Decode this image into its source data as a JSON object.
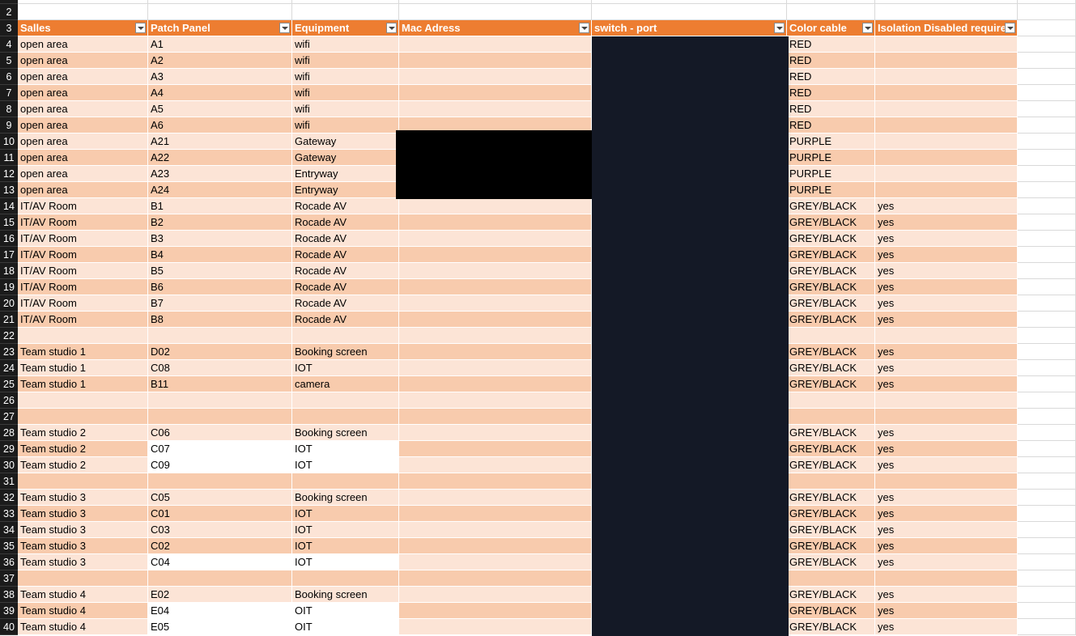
{
  "spreadsheet": {
    "columns": [
      "Salles",
      "Patch Panel",
      "Equipment",
      "Mac Adress",
      "switch - port",
      "Color cable",
      "Isolation Disabled require"
    ],
    "header_row_number": "3",
    "empty_top_rows": [
      "",
      "2"
    ],
    "rows": [
      {
        "n": "4",
        "salle": "open area",
        "patch": "A1",
        "equip": "wifi",
        "color": "RED",
        "iso": ""
      },
      {
        "n": "5",
        "salle": "open area",
        "patch": "A2",
        "equip": "wifi",
        "color": "RED",
        "iso": ""
      },
      {
        "n": "6",
        "salle": "open area",
        "patch": "A3",
        "equip": "wifi",
        "color": "RED",
        "iso": ""
      },
      {
        "n": "7",
        "salle": "open area",
        "patch": "A4",
        "equip": "wifi",
        "color": "RED",
        "iso": ""
      },
      {
        "n": "8",
        "salle": "open area",
        "patch": "A5",
        "equip": "wifi",
        "color": "RED",
        "iso": ""
      },
      {
        "n": "9",
        "salle": "open area",
        "patch": "A6",
        "equip": "wifi",
        "color": "RED",
        "iso": ""
      },
      {
        "n": "10",
        "salle": "open area",
        "patch": "A21",
        "equip": "Gateway",
        "color": "PURPLE",
        "iso": ""
      },
      {
        "n": "11",
        "salle": "open area",
        "patch": "A22",
        "equip": "Gateway",
        "color": "PURPLE",
        "iso": ""
      },
      {
        "n": "12",
        "salle": "open area",
        "patch": "A23",
        "equip": "Entryway",
        "color": "PURPLE",
        "iso": ""
      },
      {
        "n": "13",
        "salle": "open area",
        "patch": "A24",
        "equip": "Entryway",
        "color": "PURPLE",
        "iso": ""
      },
      {
        "n": "14",
        "salle": "IT/AV Room",
        "patch": "B1",
        "equip": "Rocade AV",
        "color": "GREY/BLACK",
        "iso": "yes"
      },
      {
        "n": "15",
        "salle": "IT/AV Room",
        "patch": "B2",
        "equip": "Rocade AV",
        "color": "GREY/BLACK",
        "iso": "yes"
      },
      {
        "n": "16",
        "salle": "IT/AV Room",
        "patch": "B3",
        "equip": "Rocade AV",
        "color": "GREY/BLACK",
        "iso": "yes"
      },
      {
        "n": "17",
        "salle": "IT/AV Room",
        "patch": "B4",
        "equip": "Rocade AV",
        "color": "GREY/BLACK",
        "iso": "yes"
      },
      {
        "n": "18",
        "salle": "IT/AV Room",
        "patch": "B5",
        "equip": "Rocade AV",
        "color": "GREY/BLACK",
        "iso": "yes"
      },
      {
        "n": "19",
        "salle": "IT/AV Room",
        "patch": "B6",
        "equip": "Rocade AV",
        "color": "GREY/BLACK",
        "iso": "yes"
      },
      {
        "n": "20",
        "salle": "IT/AV Room",
        "patch": "B7",
        "equip": "Rocade AV",
        "color": "GREY/BLACK",
        "iso": "yes"
      },
      {
        "n": "21",
        "salle": "IT/AV Room",
        "patch": "B8",
        "equip": "Rocade AV",
        "color": "GREY/BLACK",
        "iso": "yes"
      },
      {
        "n": "22",
        "salle": "",
        "patch": "",
        "equip": "",
        "color": "",
        "iso": ""
      },
      {
        "n": "23",
        "salle": "Team studio 1",
        "patch": "D02",
        "equip": "Booking screen",
        "color": "GREY/BLACK",
        "iso": "yes"
      },
      {
        "n": "24",
        "salle": "Team studio 1",
        "patch": "C08",
        "equip": "IOT",
        "color": "GREY/BLACK",
        "iso": "yes"
      },
      {
        "n": "25",
        "salle": "Team studio 1",
        "patch": "B11",
        "equip": "camera",
        "color": "GREY/BLACK",
        "iso": "yes"
      },
      {
        "n": "26",
        "salle": "",
        "patch": "",
        "equip": "",
        "color": "",
        "iso": ""
      },
      {
        "n": "27",
        "salle": "",
        "patch": "",
        "equip": "",
        "color": "",
        "iso": ""
      },
      {
        "n": "28",
        "salle": "Team studio 2",
        "patch": "C06",
        "equip": "Booking screen",
        "color": "GREY/BLACK",
        "iso": "yes"
      },
      {
        "n": "29",
        "salle": "Team studio 2",
        "patch": "C07",
        "equip": "IOT",
        "color": "GREY/BLACK",
        "iso": "yes",
        "white": true
      },
      {
        "n": "30",
        "salle": "Team studio 2",
        "patch": "C09",
        "equip": "IOT",
        "color": "GREY/BLACK",
        "iso": "yes",
        "white": true
      },
      {
        "n": "31",
        "salle": "",
        "patch": "",
        "equip": "",
        "color": "",
        "iso": ""
      },
      {
        "n": "32",
        "salle": "Team studio 3",
        "patch": "C05",
        "equip": "Booking screen",
        "color": "GREY/BLACK",
        "iso": "yes"
      },
      {
        "n": "33",
        "salle": "Team studio 3",
        "patch": "C01",
        "equip": "IOT",
        "color": "GREY/BLACK",
        "iso": "yes"
      },
      {
        "n": "34",
        "salle": "Team studio 3",
        "patch": "C03",
        "equip": "IOT",
        "color": "GREY/BLACK",
        "iso": "yes"
      },
      {
        "n": "35",
        "salle": "Team studio 3",
        "patch": "C02",
        "equip": "IOT",
        "color": "GREY/BLACK",
        "iso": "yes"
      },
      {
        "n": "36",
        "salle": "Team studio 3",
        "patch": "C04",
        "equip": "IOT",
        "color": "GREY/BLACK",
        "iso": "yes",
        "white": true
      },
      {
        "n": "37",
        "salle": "",
        "patch": "",
        "equip": "",
        "color": "",
        "iso": ""
      },
      {
        "n": "38",
        "salle": "Team studio 4",
        "patch": "E02",
        "equip": "Booking screen",
        "color": "GREY/BLACK",
        "iso": "yes"
      },
      {
        "n": "39",
        "salle": "Team studio 4",
        "patch": "E04",
        "equip": "OIT",
        "color": "GREY/BLACK",
        "iso": "yes",
        "white": true
      },
      {
        "n": "40",
        "salle": "Team studio 4",
        "patch": "E05",
        "equip": "OIT",
        "color": "GREY/BLACK",
        "iso": "yes",
        "white": true
      }
    ]
  },
  "colors": {
    "header_fill": "#ed7d31",
    "band_dark": "#f8cbad",
    "band_light": "#fce4d6",
    "redaction_dark": "#141926",
    "redaction_black": "#000000"
  }
}
